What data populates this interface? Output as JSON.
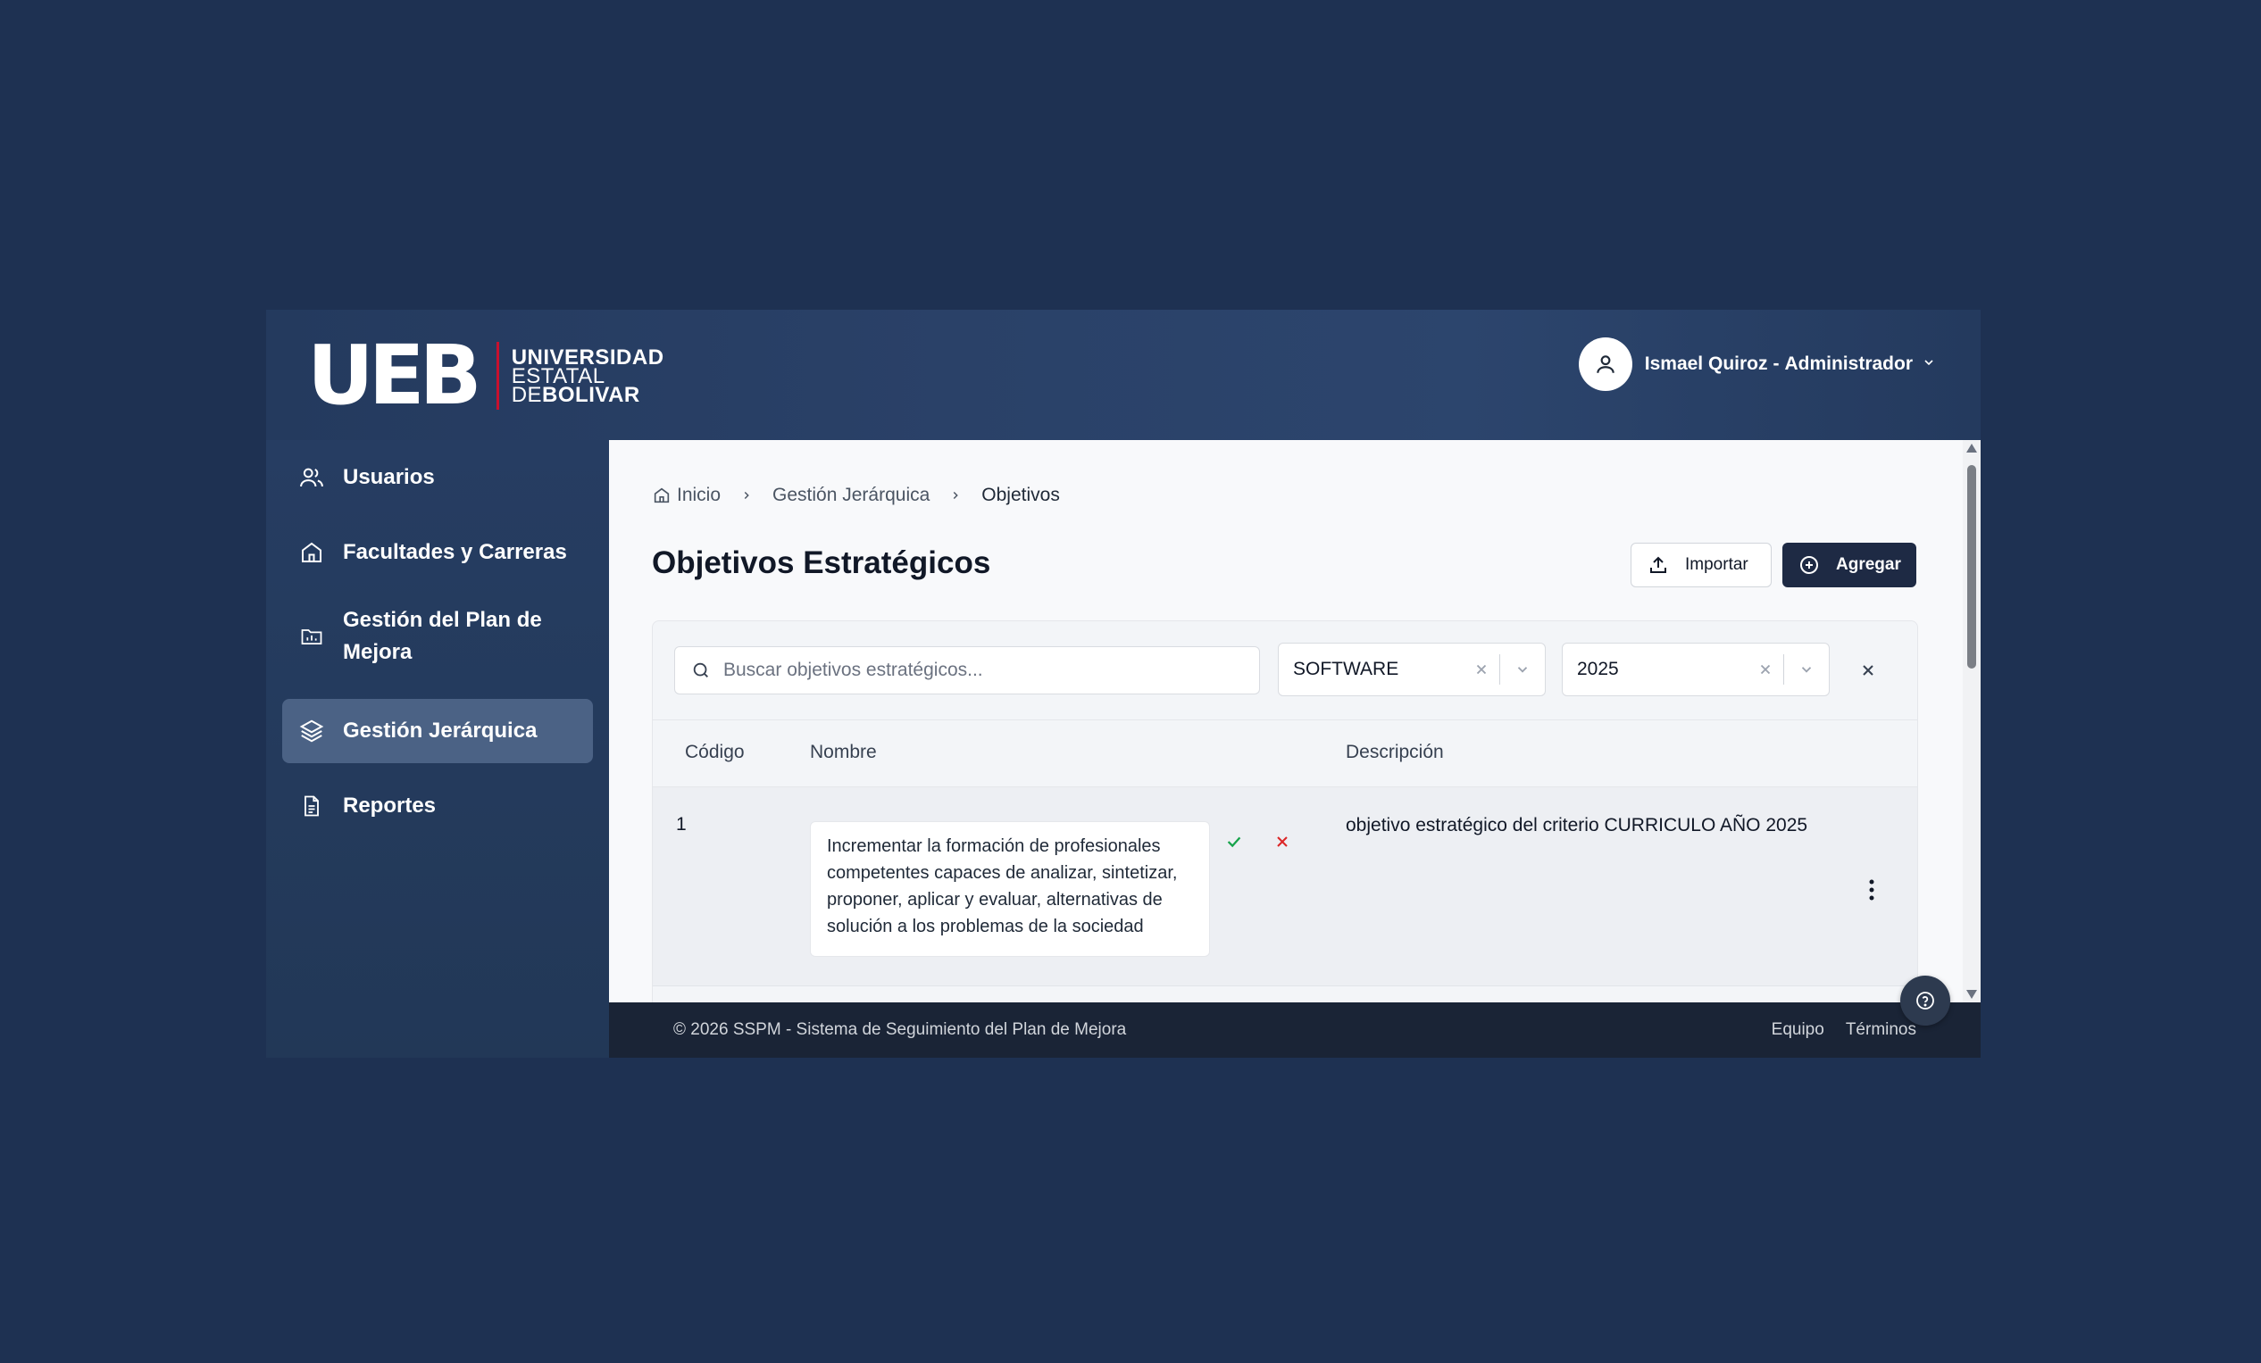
{
  "brand": {
    "logo_mark": "UEB",
    "line1": "UNIVERSIDAD",
    "line2": "ESTATAL",
    "line3_prefix": "DE",
    "line3_bold": "BOLIVAR",
    "accent_color": "#c8102e"
  },
  "user": {
    "name": "Ismael Quiroz",
    "separator": "-",
    "role": "Administrador",
    "avatar_icon": "user-icon"
  },
  "sidebar": {
    "items": [
      {
        "label": "Usuarios",
        "icon": "users-icon"
      },
      {
        "label": "Facultades y Carreras",
        "icon": "home-icon"
      },
      {
        "label": "Gestión del Plan de Mejora",
        "icon": "chart-folder-icon"
      },
      {
        "label": "Gestión Jerárquica",
        "icon": "layers-icon",
        "active": true
      },
      {
        "label": "Reportes",
        "icon": "document-icon"
      }
    ]
  },
  "breadcrumb": {
    "items": [
      "Inicio",
      "Gestión Jerárquica",
      "Objetivos"
    ]
  },
  "page": {
    "title": "Objetivos Estratégicos",
    "import_label": "Importar",
    "add_label": "Agregar"
  },
  "filters": {
    "search_placeholder": "Buscar objetivos estratégicos...",
    "search_value": "",
    "career": "SOFTWARE",
    "year": "2025"
  },
  "table": {
    "columns": [
      "Código",
      "Nombre",
      "Descripción"
    ],
    "rows": [
      {
        "code": "1",
        "name": "Incrementar la formación de profesionales competentes capaces de analizar, sintetizar, proponer, aplicar y evaluar, alternativas de solución a los problemas de la sociedad",
        "description": "objetivo estratégico del criterio CURRICULO AÑO 2025"
      }
    ]
  },
  "footer": {
    "copyright": "© 2026 SSPM - Sistema de Seguimiento del Plan de Mejora",
    "links": [
      "Equipo",
      "Términos"
    ]
  },
  "colors": {
    "background": "#1e3152",
    "header": "#243a5e",
    "primary_button": "#1e2a44",
    "active_nav": "#4b6285",
    "success": "#16a34a",
    "danger": "#dc2626"
  }
}
